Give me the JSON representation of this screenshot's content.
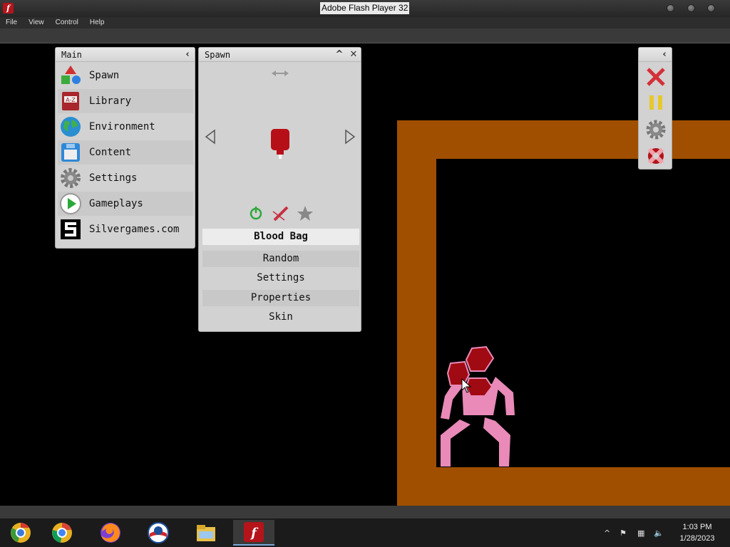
{
  "window": {
    "title": "Adobe Flash Player 32"
  },
  "menubar": {
    "items": [
      "File",
      "View",
      "Control",
      "Help"
    ]
  },
  "main_panel": {
    "title": "Main",
    "items": [
      {
        "label": "Spawn",
        "icon": "shapes-icon"
      },
      {
        "label": "Library",
        "icon": "book-icon"
      },
      {
        "label": "Environment",
        "icon": "globe-icon"
      },
      {
        "label": "Content",
        "icon": "floppy-icon"
      },
      {
        "label": "Settings",
        "icon": "gear-icon"
      },
      {
        "label": "Gameplays",
        "icon": "play-icon"
      },
      {
        "label": "Silvergames.com",
        "icon": "silvergames-logo-icon"
      }
    ]
  },
  "spawn_panel": {
    "title": "Spawn",
    "selected_item": "Blood Bag",
    "buttons": [
      "Random",
      "Settings",
      "Properties",
      "Skin"
    ]
  },
  "taskbar": {
    "time": "1:03 PM",
    "date": "1/28/2023",
    "apps": [
      "chrome-legacy",
      "chrome",
      "firefox",
      "obama-app",
      "file-explorer",
      "flash-player"
    ]
  },
  "colors": {
    "wall": "#a04f00",
    "figure": "#e98ab8",
    "blood": "#a00a12",
    "panel": "#d2d2d2"
  }
}
